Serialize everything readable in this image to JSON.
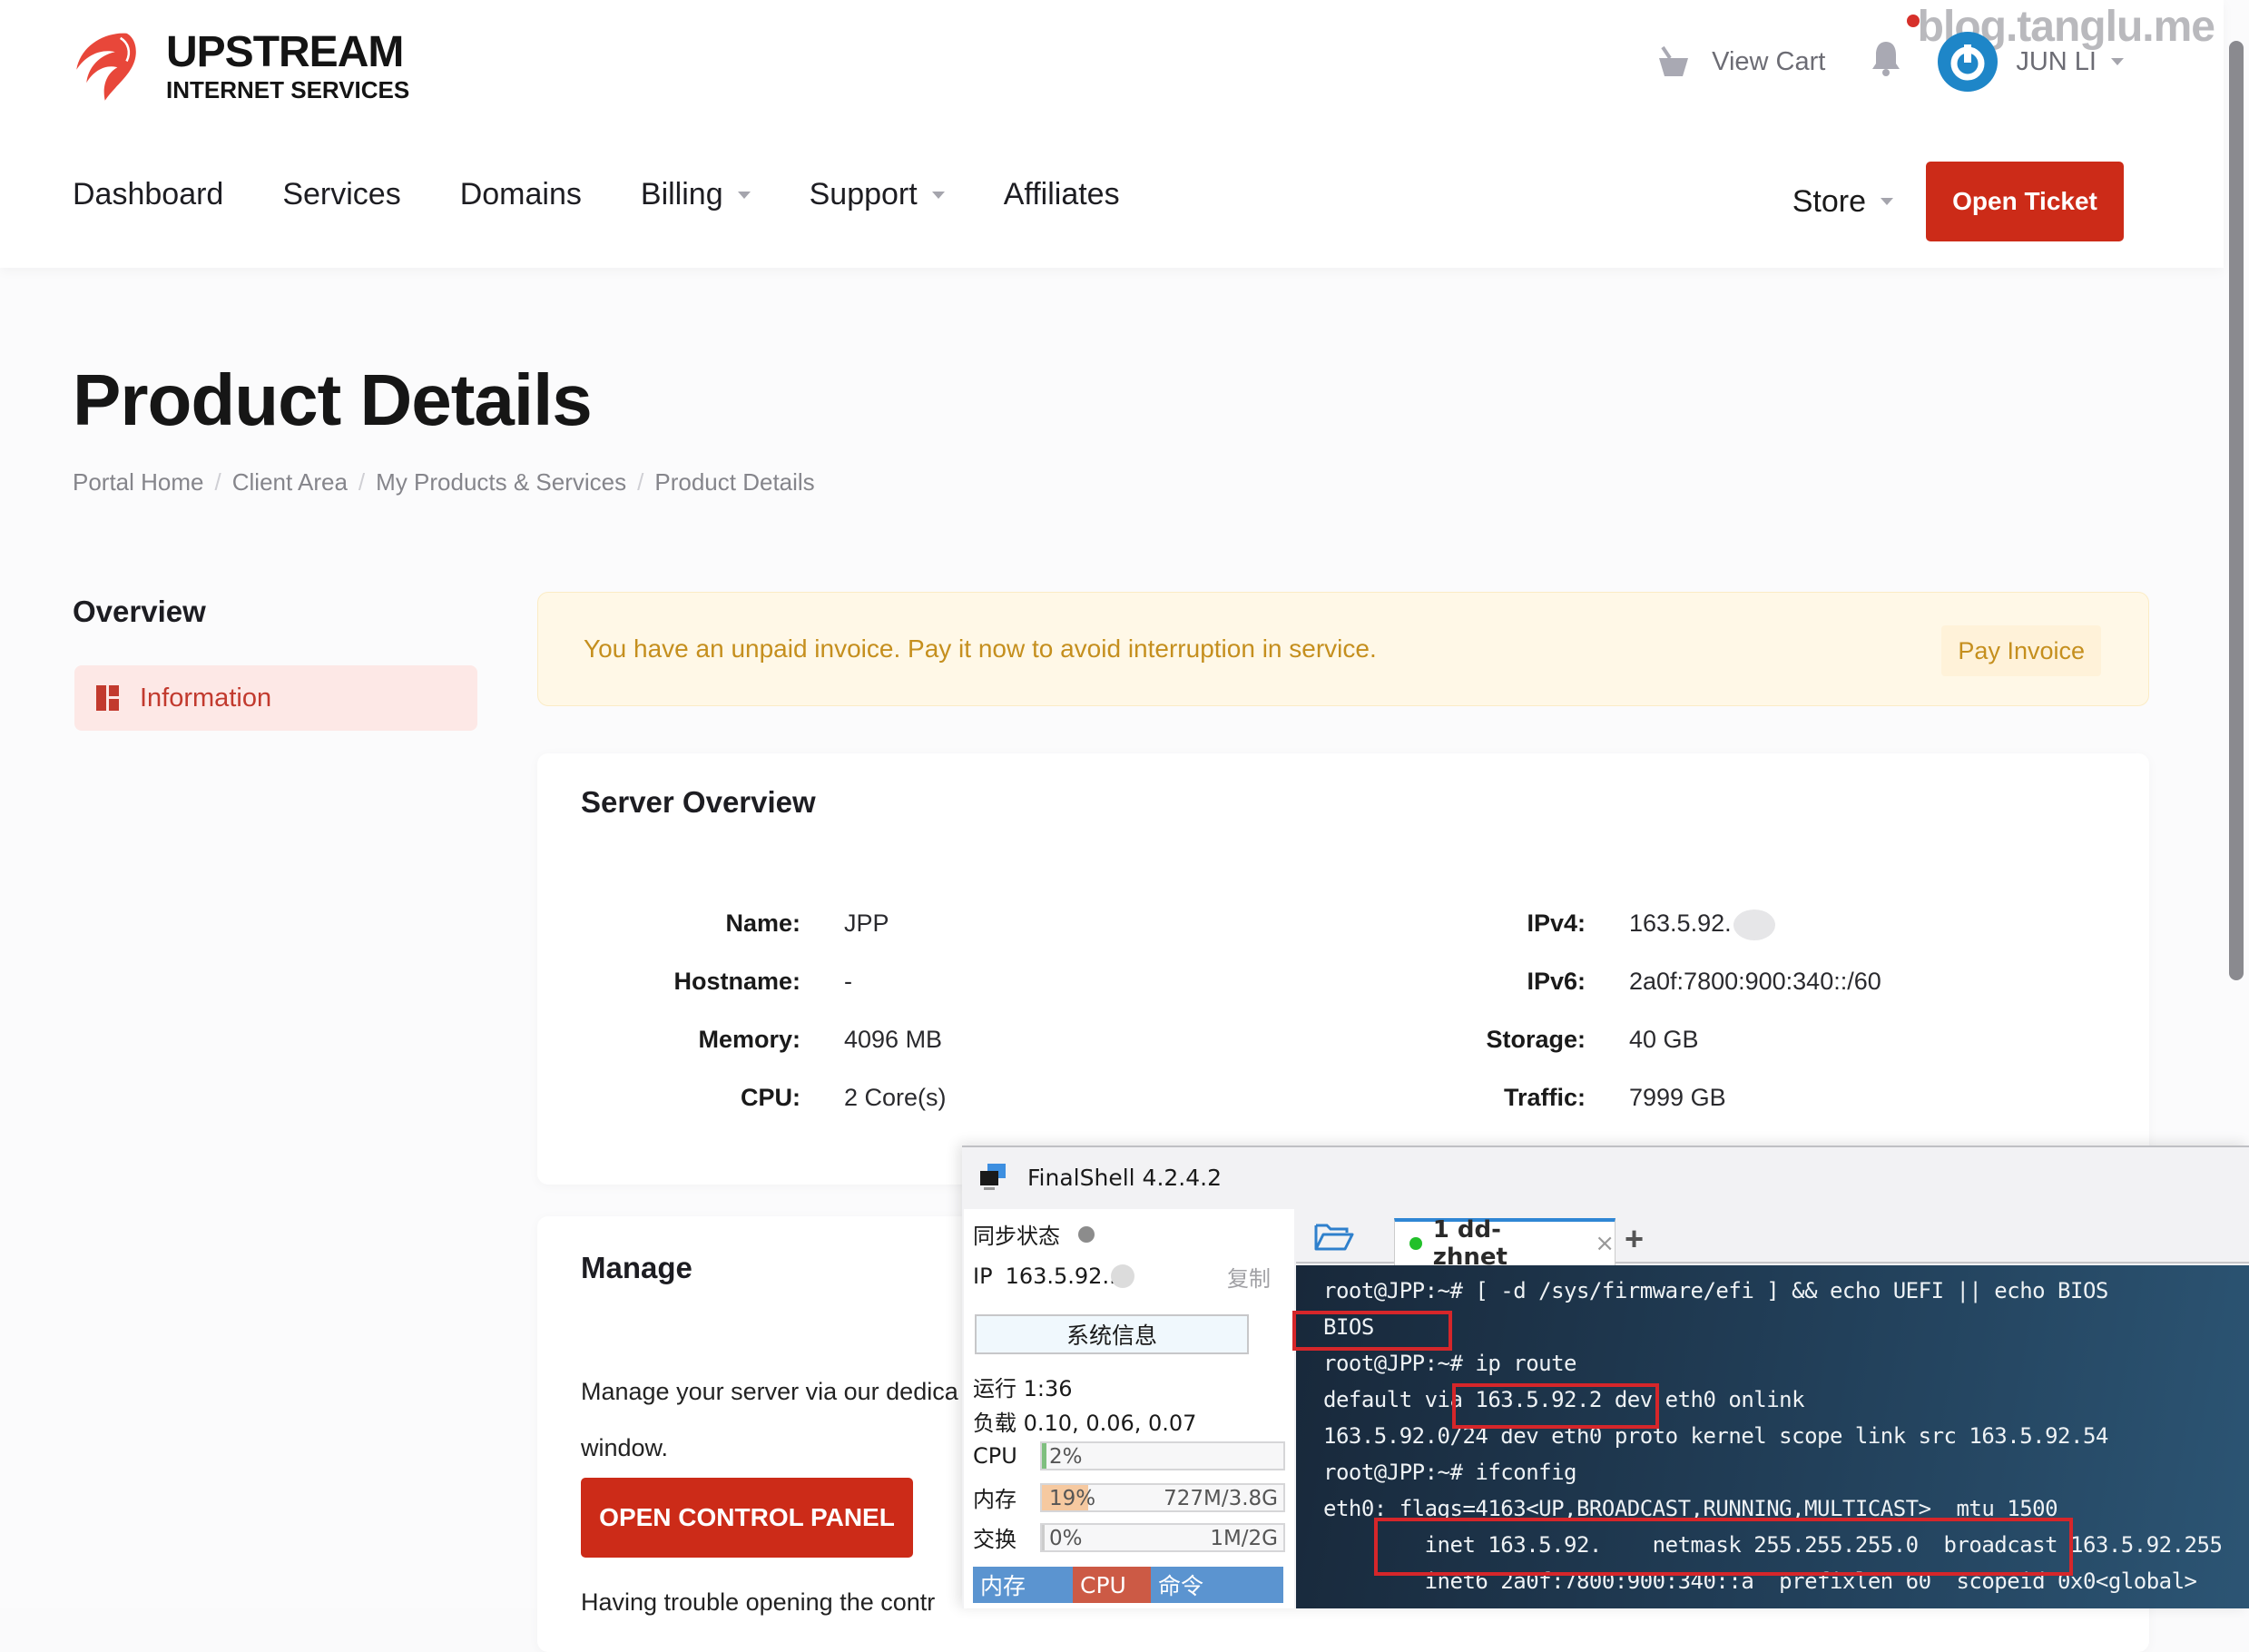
{
  "brand": {
    "line1": "UPSTREAM",
    "line2": "INTERNET SERVICES",
    "accent": "#cc2b18"
  },
  "watermark": "blog.tanglu.me",
  "topbar": {
    "cart_label": "View Cart",
    "cart_icon": "basket-icon",
    "bell_icon": "bell-icon",
    "has_notification": true,
    "user_name": "JUN LI"
  },
  "nav": {
    "items": [
      {
        "label": "Dashboard",
        "dropdown": false
      },
      {
        "label": "Services",
        "dropdown": false
      },
      {
        "label": "Domains",
        "dropdown": false
      },
      {
        "label": "Billing",
        "dropdown": true
      },
      {
        "label": "Support",
        "dropdown": true
      },
      {
        "label": "Affiliates",
        "dropdown": false
      }
    ],
    "store_label": "Store",
    "open_ticket_label": "Open Ticket"
  },
  "page": {
    "title": "Product Details",
    "breadcrumb": [
      "Portal Home",
      "Client Area",
      "My Products & Services",
      "Product Details"
    ]
  },
  "sidebar": {
    "title": "Overview",
    "items": [
      {
        "label": "Information",
        "active": true
      }
    ]
  },
  "alert": {
    "message": "You have an unpaid invoice. Pay it now to avoid interruption in service.",
    "button": "Pay Invoice"
  },
  "server_overview": {
    "title": "Server Overview",
    "left": [
      {
        "label": "Name:",
        "value": "JPP"
      },
      {
        "label": "Hostname:",
        "value": "-"
      },
      {
        "label": "Memory:",
        "value": "4096 MB"
      },
      {
        "label": "CPU:",
        "value": "2 Core(s)"
      }
    ],
    "right": [
      {
        "label": "IPv4:",
        "value": "163.5.92."
      },
      {
        "label": "IPv6:",
        "value": "2a0f:7800:900:340::/60"
      },
      {
        "label": "Storage:",
        "value": "40 GB"
      },
      {
        "label": "Traffic:",
        "value": "7999 GB"
      }
    ]
  },
  "manage": {
    "title": "Manage",
    "text": "Manage your server via our dedicated control panel in a new window.",
    "visible_text_line1": "Manage your server via our dedica",
    "visible_text_line2": "window.",
    "button": "OPEN CONTROL PANEL",
    "trouble_text": "Having trouble opening the contr"
  },
  "finalshell": {
    "title": "FinalShell 4.2.4.2",
    "sync_label": "同步状态",
    "ip_label": "IP",
    "ip_value": "163.5.92..",
    "copy_label": "复制",
    "sysinfo_button": "系统信息",
    "uptime": "运行 1:36",
    "load": "负载 0.10, 0.06, 0.07",
    "meters": [
      {
        "label": "CPU",
        "percent": 2,
        "text": "2%",
        "amount": "",
        "color": "#7fbf7f"
      },
      {
        "label": "内存",
        "percent": 19,
        "text": "19%",
        "amount": "727M/3.8G",
        "color": "#f6c9a0"
      },
      {
        "label": "交换",
        "percent": 0,
        "text": "0%",
        "amount": "1M/2G",
        "color": "#cccccc"
      }
    ],
    "process_headers": [
      {
        "label": "内存",
        "color": "#5b94d0"
      },
      {
        "label": "CPU",
        "color": "#cc5a45"
      },
      {
        "label": "命令",
        "color": "#5b94d0"
      }
    ],
    "tab": {
      "label": "1 dd-zhnet",
      "connected": true
    },
    "terminal": [
      "root@JPP:~# [ -d /sys/firmware/efi ] && echo UEFI || echo BIOS",
      "BIOS",
      "root@JPP:~# ip route",
      "default via 163.5.92.2 dev eth0 onlink",
      "163.5.92.0/24 dev eth0 proto kernel scope link src 163.5.92.54",
      "root@JPP:~# ifconfig",
      "eth0: flags=4163<UP,BROADCAST,RUNNING,MULTICAST>  mtu 1500",
      "        inet 163.5.92.    netmask 255.255.255.0  broadcast 163.5.92.255",
      "        inet6 2a0f:7800:900:340::a  prefixlen 60  scopeid 0x0<global>"
    ]
  }
}
